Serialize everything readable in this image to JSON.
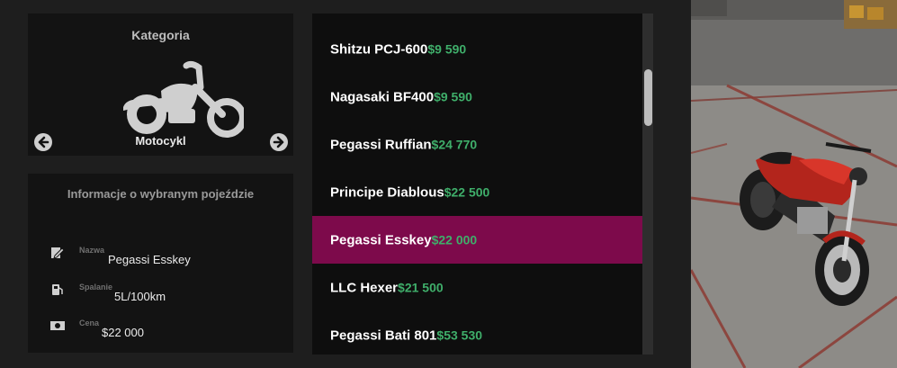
{
  "category_panel": {
    "title": "Kategoria",
    "current_category": "Motocykl",
    "icon": "motorcycle-icon",
    "prev_icon": "arrow-left-circle-icon",
    "next_icon": "arrow-right-circle-icon"
  },
  "info_panel": {
    "title": "Informacje o wybranym pojeździe",
    "rows": [
      {
        "icon": "pencil-note-icon",
        "label": "Nazwa",
        "value": "Pegassi Esskey"
      },
      {
        "icon": "fuel-pump-icon",
        "label": "Spalanie",
        "value": "5L/100km"
      },
      {
        "icon": "money-bill-icon",
        "label": "Cena",
        "value": "$22 000"
      }
    ]
  },
  "vehicle_list": {
    "items": [
      {
        "name": "Shitzu PCJ-600",
        "price": "$9 590",
        "selected": false
      },
      {
        "name": "Nagasaki BF400",
        "price": "$9 590",
        "selected": false
      },
      {
        "name": "Pegassi Ruffian",
        "price": "$24 770",
        "selected": false
      },
      {
        "name": "Principe Diablous",
        "price": "$22 500",
        "selected": false
      },
      {
        "name": "Pegassi Esskey",
        "price": "$22 000",
        "selected": true
      },
      {
        "name": "LLC Hexer",
        "price": "$21 500",
        "selected": false
      },
      {
        "name": "Pegassi Bati 801",
        "price": "$53 530",
        "selected": false
      }
    ]
  },
  "colors": {
    "selected_row": "#7d0a4b",
    "price_green": "#3fae6a",
    "panel_bg": "#131313"
  }
}
